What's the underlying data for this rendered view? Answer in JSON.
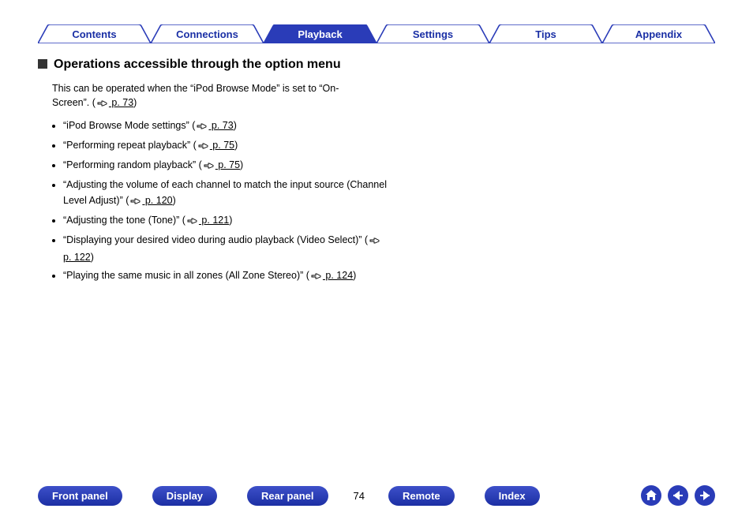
{
  "tabs": [
    {
      "label": "Contents",
      "active": false
    },
    {
      "label": "Connections",
      "active": false
    },
    {
      "label": "Playback",
      "active": true
    },
    {
      "label": "Settings",
      "active": false
    },
    {
      "label": "Tips",
      "active": false
    },
    {
      "label": "Appendix",
      "active": false
    }
  ],
  "heading": "Operations accessible through the option menu",
  "intro_pre": "This can be operated when the “iPod Browse Mode” is set to “On-Screen”.  (",
  "intro_link": " p. 73",
  "intro_post": ")",
  "ops": [
    {
      "pre": "“iPod Browse Mode settings” (",
      "link": " p. 73",
      "post": ")"
    },
    {
      "pre": "“Performing repeat playback” (",
      "link": " p. 75",
      "post": ")"
    },
    {
      "pre": "“Performing random playback” (",
      "link": " p. 75",
      "post": ")"
    },
    {
      "pre": "“Adjusting the volume of each channel to match the input source (Channel Level Adjust)” (",
      "link": " p. 120",
      "post": ")"
    },
    {
      "pre": "“Adjusting the tone (Tone)” (",
      "link": " p. 121",
      "post": ")"
    },
    {
      "pre": "“Displaying your desired video during audio playback (Video Select)” (",
      "link": " p. 122",
      "post": ")"
    },
    {
      "pre": "“Playing the same music in all zones (All Zone Stereo)” (",
      "link": " p. 124",
      "post": ")"
    }
  ],
  "bottom": {
    "front": "Front panel",
    "display": "Display",
    "rear": "Rear panel",
    "page": "74",
    "remote": "Remote",
    "index": "Index"
  }
}
